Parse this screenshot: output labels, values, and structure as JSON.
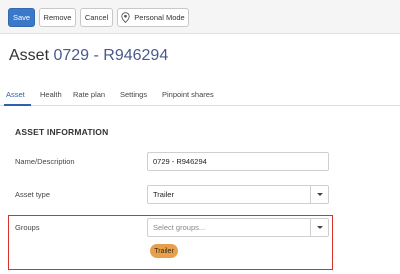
{
  "toolbar": {
    "save_label": "Save",
    "remove_label": "Remove",
    "cancel_label": "Cancel",
    "personal_mode_label": "Personal Mode",
    "personal_mode_icon": "map-pin-icon"
  },
  "header": {
    "title_prefix": "Asset",
    "title_id": "0729 - R946294"
  },
  "tabs": [
    {
      "label": "Asset",
      "active": true
    },
    {
      "label": "Health",
      "active": false
    },
    {
      "label": "Rate plan",
      "active": false
    },
    {
      "label": "Settings",
      "active": false
    },
    {
      "label": "Pinpoint shares",
      "active": false
    }
  ],
  "form": {
    "section_title": "ASSET INFORMATION",
    "name": {
      "label": "Name/Description",
      "value": "0729 - R946294"
    },
    "asset_type": {
      "label": "Asset type",
      "value": "Trailer"
    },
    "groups": {
      "label": "Groups",
      "placeholder": "Select groups...",
      "selected": [
        "Trailer"
      ]
    }
  },
  "colors": {
    "primary_button": "#3c78c9",
    "active_tab": "#2f62ad",
    "highlight_border": "#d9322b",
    "group_badge": "#e8a04c"
  }
}
